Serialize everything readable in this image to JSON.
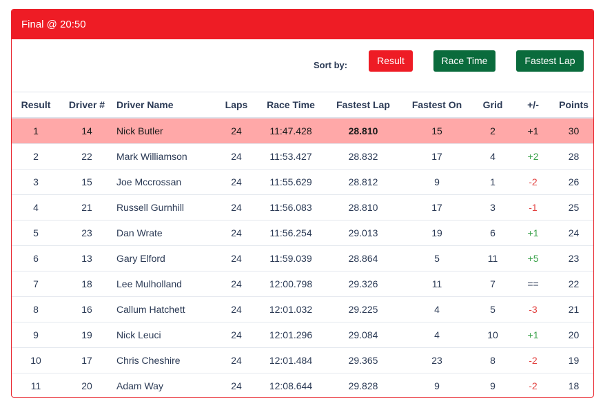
{
  "header": {
    "title": "Final @ 20:50"
  },
  "toolbar": {
    "sort_label": "Sort by:",
    "buttons": {
      "result": "Result",
      "race_time": "Race Time",
      "fastest_lap": "Fastest Lap"
    }
  },
  "colors": {
    "header_red": "#ee1c25",
    "button_green": "#0a6b3c",
    "highlight_row": "#ffa8a8",
    "positive": "#3aa24a",
    "negative": "#e2403e"
  },
  "table": {
    "columns": [
      "Result",
      "Driver #",
      "Driver Name",
      "Laps",
      "Race Time",
      "Fastest Lap",
      "Fastest On",
      "Grid",
      "+/-",
      "Points"
    ],
    "rows": [
      [
        "1",
        "14",
        "Nick Butler",
        "24",
        "11:47.428",
        "28.810",
        "15",
        "2",
        "+1",
        "30"
      ],
      [
        "2",
        "22",
        "Mark Williamson",
        "24",
        "11:53.427",
        "28.832",
        "17",
        "4",
        "+2",
        "28"
      ],
      [
        "3",
        "15",
        "Joe Mccrossan",
        "24",
        "11:55.629",
        "28.812",
        "9",
        "1",
        "-2",
        "26"
      ],
      [
        "4",
        "21",
        "Russell Gurnhill",
        "24",
        "11:56.083",
        "28.810",
        "17",
        "3",
        "-1",
        "25"
      ],
      [
        "5",
        "23",
        "Dan Wrate",
        "24",
        "11:56.254",
        "29.013",
        "19",
        "6",
        "+1",
        "24"
      ],
      [
        "6",
        "13",
        "Gary Elford",
        "24",
        "11:59.039",
        "28.864",
        "5",
        "11",
        "+5",
        "23"
      ],
      [
        "7",
        "18",
        "Lee Mulholland",
        "24",
        "12:00.798",
        "29.326",
        "11",
        "7",
        "==",
        "22"
      ],
      [
        "8",
        "16",
        "Callum Hatchett",
        "24",
        "12:01.032",
        "29.225",
        "4",
        "5",
        "-3",
        "21"
      ],
      [
        "9",
        "19",
        "Nick Leuci",
        "24",
        "12:01.296",
        "29.084",
        "4",
        "10",
        "+1",
        "20"
      ],
      [
        "10",
        "17",
        "Chris Cheshire",
        "24",
        "12:01.484",
        "29.365",
        "23",
        "8",
        "-2",
        "19"
      ],
      [
        "11",
        "20",
        "Adam Way",
        "24",
        "12:08.644",
        "29.828",
        "9",
        "9",
        "-2",
        "18"
      ]
    ]
  }
}
